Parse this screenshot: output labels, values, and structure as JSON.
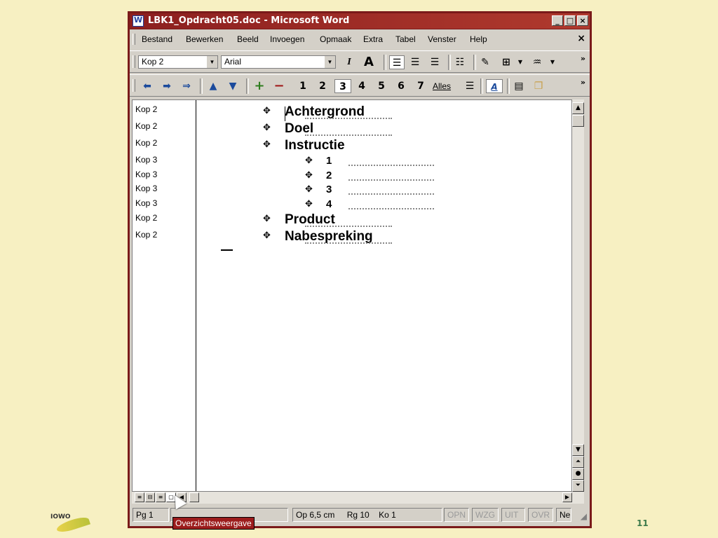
{
  "window": {
    "title": "LBK1_Opdracht05.doc - Microsoft Word",
    "controls": [
      "_",
      "□",
      "×"
    ]
  },
  "menubar": {
    "items": [
      "Bestand",
      "Bewerken",
      "Beeld",
      "Invoegen",
      "Opmaak",
      "Extra",
      "Tabel",
      "Venster",
      "Help"
    ],
    "doc_close": "×"
  },
  "format_toolbar": {
    "style_value": "Kop 2",
    "font_value": "Arial",
    "italic": "I",
    "grow_font": "A",
    "more": "»"
  },
  "outline_toolbar": {
    "promote": "◆",
    "demote": "➡",
    "demote_body": "⇒",
    "move_up": "▲",
    "move_down": "▼",
    "expand": "+",
    "collapse": "−",
    "levels": [
      "1",
      "2",
      "3",
      "4",
      "5",
      "6",
      "7"
    ],
    "selected_level": "3",
    "show_all": "Alles",
    "more": "»"
  },
  "outline": {
    "styles": [
      "Kop 2",
      "Kop 2",
      "Kop 2",
      "Kop 3",
      "Kop 3",
      "Kop 3",
      "Kop 3",
      "Kop 2",
      "Kop 2"
    ],
    "headings": [
      {
        "level": 2,
        "text": "Achtergrond"
      },
      {
        "level": 2,
        "text": "Doel"
      },
      {
        "level": 2,
        "text": "Instructie"
      },
      {
        "level": 3,
        "text": "1"
      },
      {
        "level": 3,
        "text": "2"
      },
      {
        "level": 3,
        "text": "3"
      },
      {
        "level": 3,
        "text": "4"
      },
      {
        "level": 2,
        "text": "Product"
      },
      {
        "level": 2,
        "text": "Nabespreking"
      }
    ],
    "expand_symbol": "✥"
  },
  "view_buttons": [
    "≡",
    "⊟",
    "≡",
    "▢"
  ],
  "tooltip": "Overzichtsweergave",
  "statusbar": {
    "page": "Pg 1",
    "position": "Op 6,5 cm",
    "row": "Rg 10",
    "column": "Ko 1",
    "modes": [
      "OPN",
      "WZG",
      "UIT",
      "OVR"
    ],
    "language": "Ne"
  },
  "logo_text": "IOWO",
  "slide_number": "11"
}
